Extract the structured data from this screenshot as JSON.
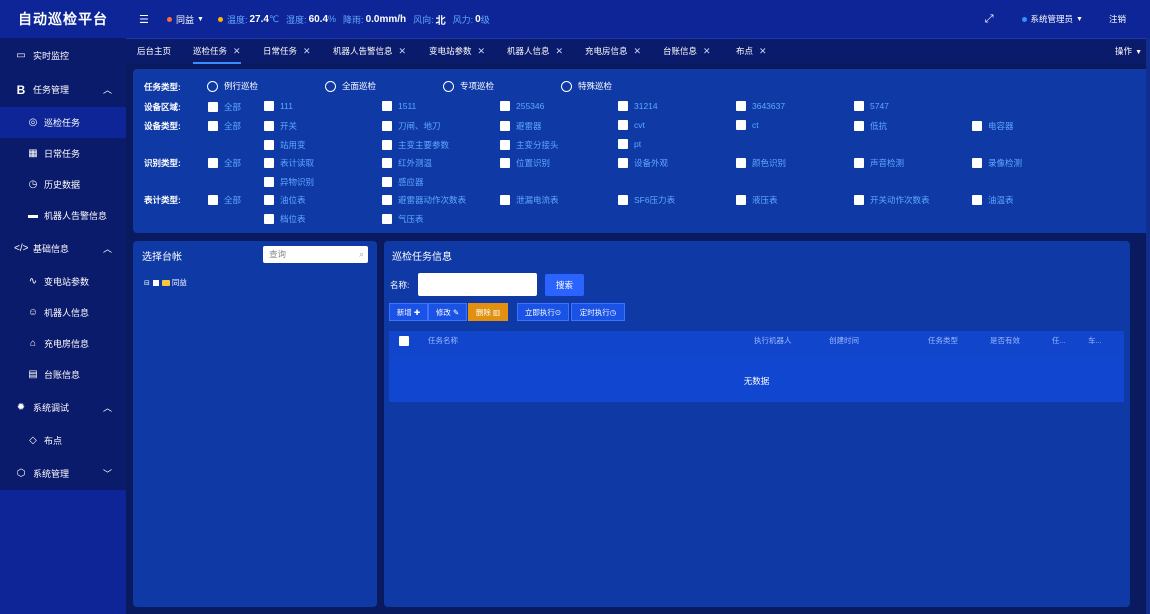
{
  "app": {
    "title": "自动巡检平台"
  },
  "header": {
    "station": "同益",
    "temp_label": "温度:",
    "temp_value": "27.4",
    "temp_unit": "℃",
    "humidity_label": "湿度:",
    "humidity_value": "60.4",
    "humidity_unit": "%",
    "rain_label": "降雨:",
    "rain_value": "0.0mm/h",
    "wind_dir_label": "风向:",
    "wind_dir_value": "北",
    "wind_power_label": "风力:",
    "wind_power_value": "0",
    "wind_power_unit": "级",
    "user": "系统管理员",
    "logout": "注销"
  },
  "menu": {
    "realtime": "实时监控",
    "task_mgmt": "任务管理",
    "patrol_task": "巡检任务",
    "daily_task": "日常任务",
    "history": "历史数据",
    "robot_alarm": "机器人告警信息",
    "basic_info": "基础信息",
    "substation_params": "变电站参数",
    "robot_info": "机器人信息",
    "charging_room": "充电房信息",
    "ledger_info": "台账信息",
    "sys_debug": "系统调试",
    "deploy_points": "布点",
    "sys_mgmt": "系统管理"
  },
  "tabs": [
    "后台主页",
    "巡检任务",
    "日常任务",
    "机器人告警信息",
    "变电站参数",
    "机器人信息",
    "充电房信息",
    "台账信息",
    "布点"
  ],
  "tabs_ops": "操作",
  "filters": {
    "task_type_label": "任务类型:",
    "task_types": [
      "例行巡检",
      "全面巡检",
      "专项巡检",
      "特殊巡检"
    ],
    "area_label": "设备区域:",
    "areas": [
      "全部",
      "111",
      "1511",
      "255346",
      "31214",
      "3643637",
      "5747"
    ],
    "device_type_label": "设备类型:",
    "device_types": [
      "全部",
      "开关",
      "刀闸、地刀",
      "避雷器",
      "cvt",
      "ct",
      "低抗",
      "电容器",
      "站用变",
      "主变主要参数",
      "主变分接头",
      "pt"
    ],
    "recog_label": "识别类型:",
    "recog_types": [
      "全部",
      "表计读取",
      "红外测温",
      "位置识别",
      "设备外观",
      "颜色识别",
      "声音检测",
      "录像检测",
      "异物识别",
      "感应器"
    ],
    "meter_label": "表计类型:",
    "meter_types": [
      "全部",
      "油位表",
      "避雷器动作次数表",
      "泄漏电流表",
      "SF6压力表",
      "液压表",
      "开关动作次数表",
      "油温表",
      "档位表",
      "气压表"
    ]
  },
  "ledger": {
    "title": "选择台帐",
    "search_placeholder": "查询",
    "tree_root": "同益"
  },
  "tasks": {
    "title": "巡检任务信息",
    "name_label": "名称:",
    "search_btn": "搜索",
    "btn_add": "新增",
    "btn_edit": "修改",
    "btn_delete": "删除",
    "btn_run_now": "立即执行",
    "btn_schedule": "定时执行",
    "columns": [
      "任务名称",
      "执行机器人",
      "创建时间",
      "任务类型",
      "是否有效",
      "任...",
      "车..."
    ],
    "empty": "无数据"
  }
}
